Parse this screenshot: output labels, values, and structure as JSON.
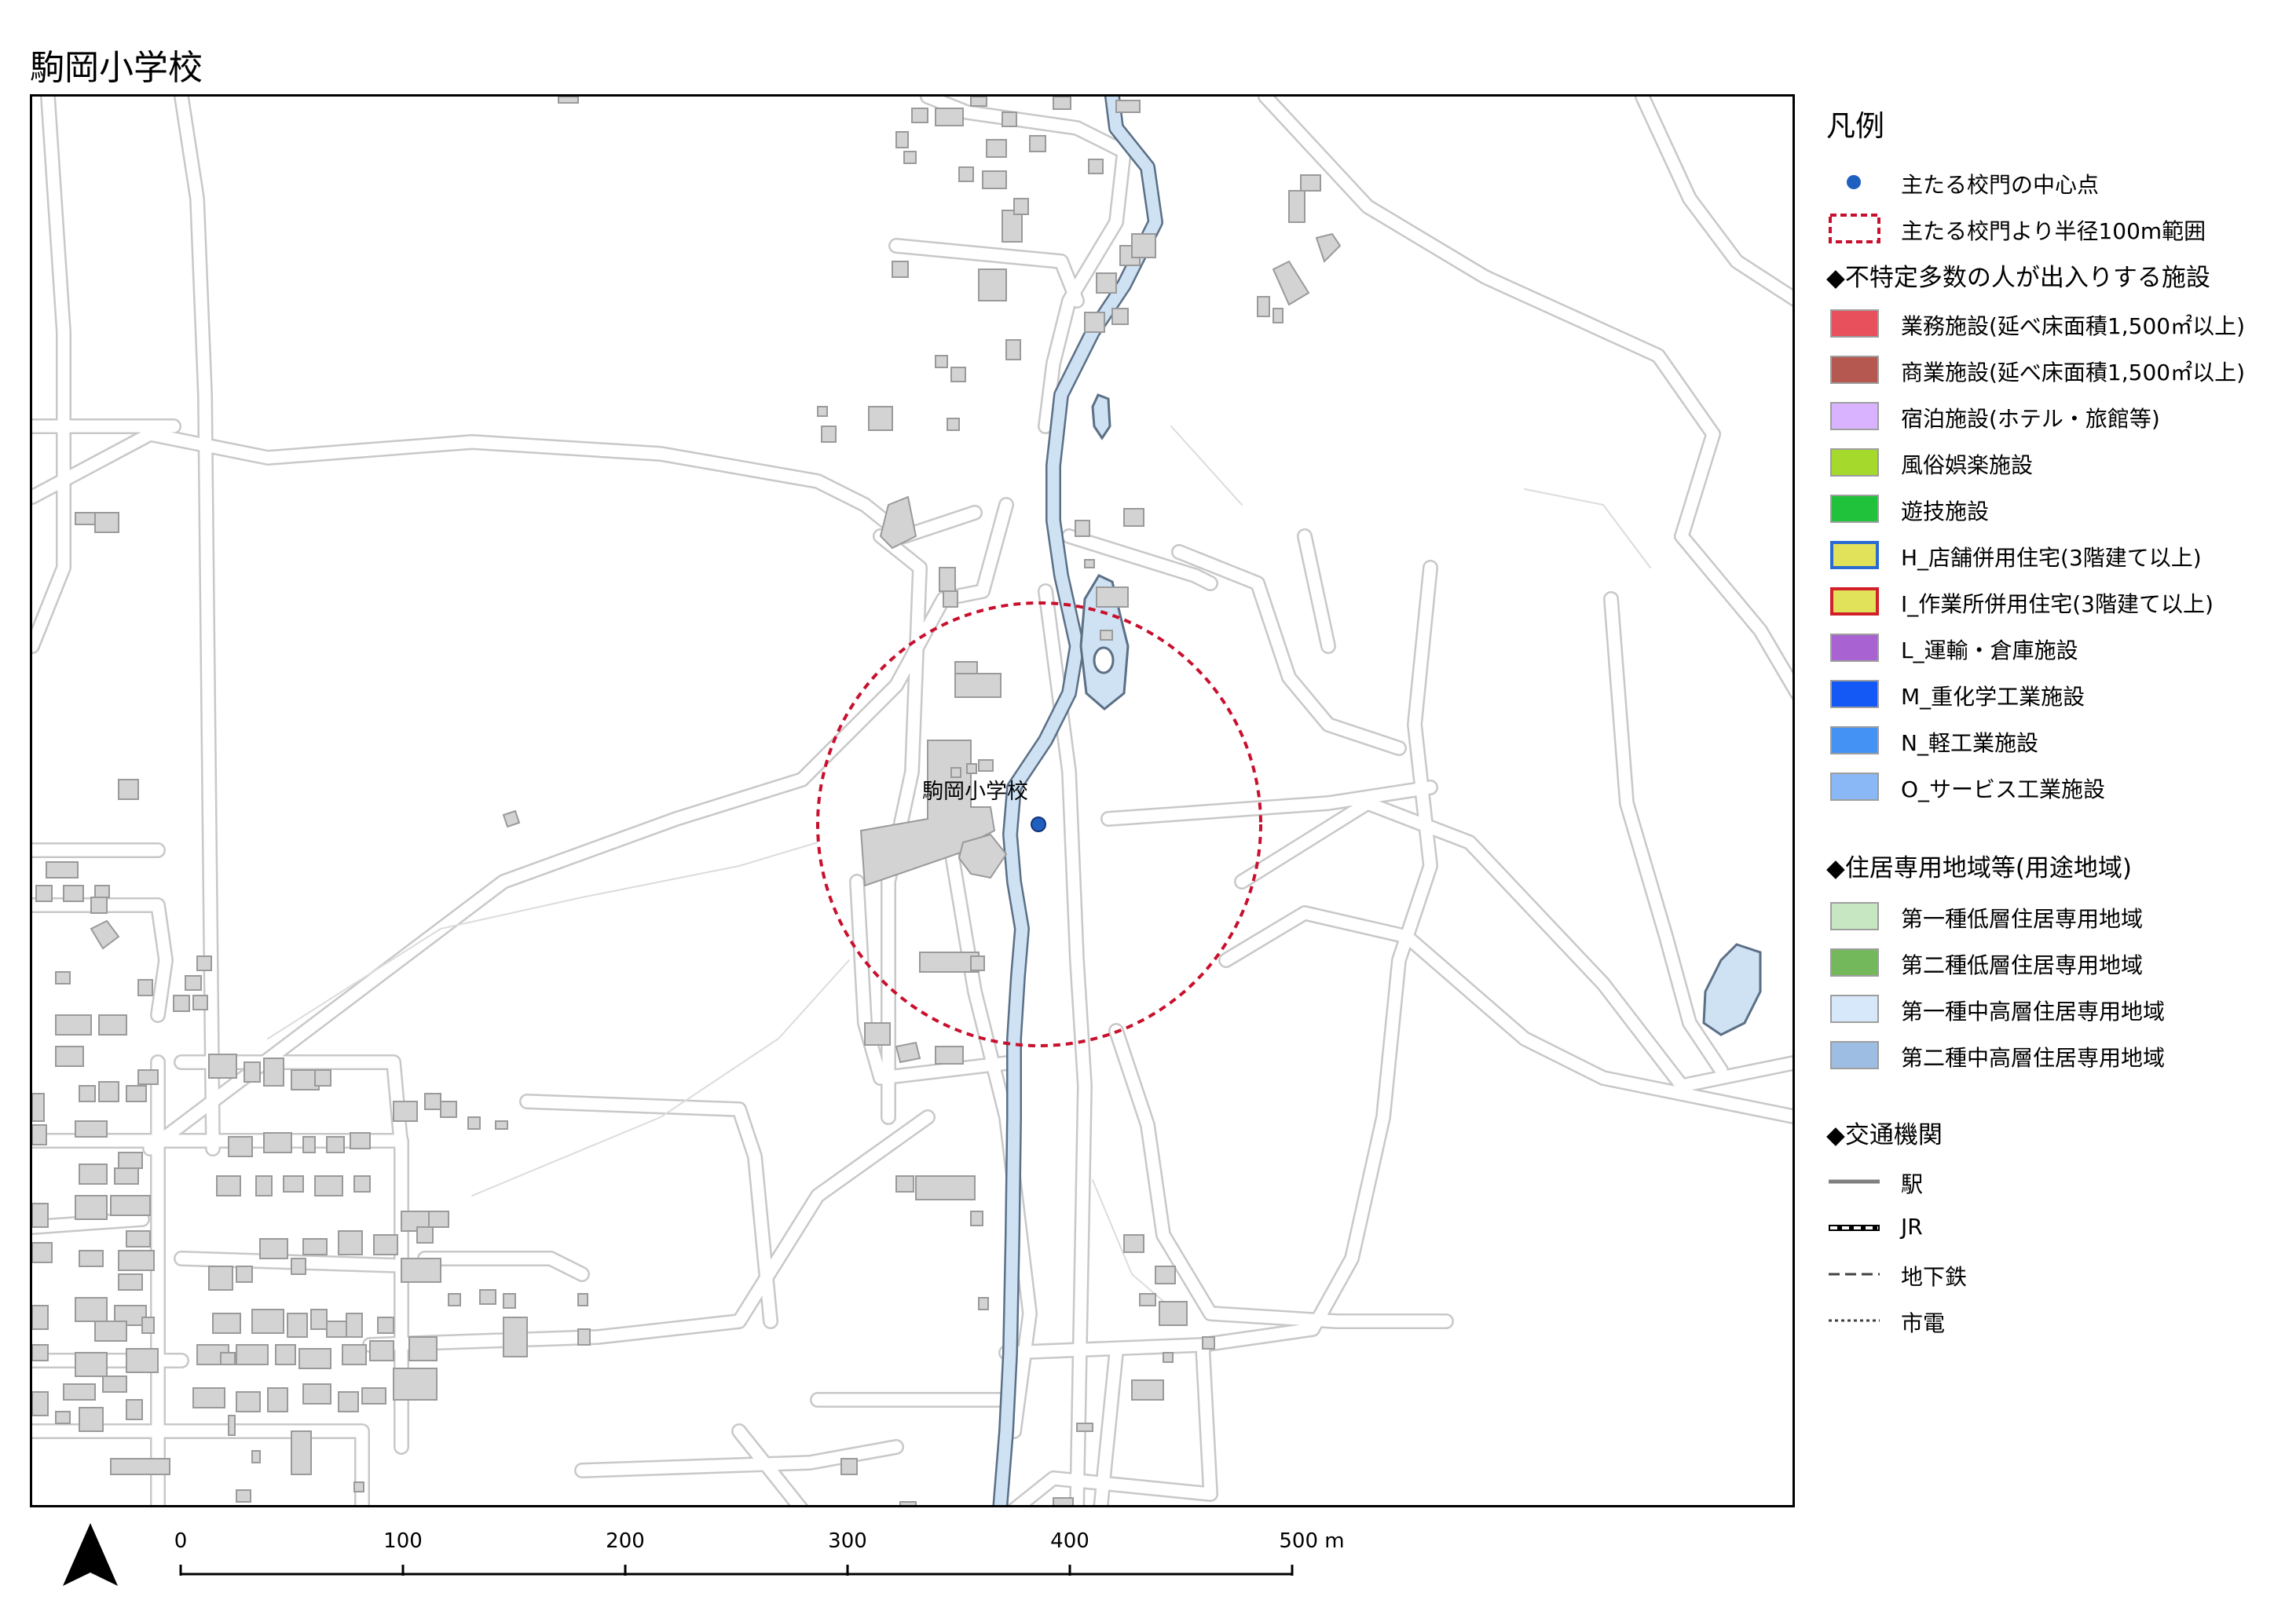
{
  "title": "駒岡小学校",
  "map": {
    "school_label": "駒岡小学校",
    "colors": {
      "building_fill": "#d3d3d3",
      "building_stroke": "#9a9a9a",
      "road": "#c8c8c8",
      "water_fill": "#cfe2f3",
      "water_stroke": "#5b6f86",
      "gate_point": "#1f5fbf",
      "buffer_circle": "#c8102e"
    }
  },
  "legend": {
    "title": "凡例",
    "items": [
      {
        "label": "主たる校門の中心点",
        "symbol": "point",
        "color": "#1f5fbf"
      },
      {
        "label": "主たる校門より半径100m範囲",
        "symbol": "dashed-box",
        "color": "#c8102e"
      }
    ],
    "section_facilities": "◆不特定多数の人が出入りする施設",
    "facilities": [
      {
        "label": "業務施設(延べ床面積1,500㎡以上)",
        "fill": "#e8505b",
        "border": "#9e9e9e"
      },
      {
        "label": "商業施設(延べ床面積1,500㎡以上)",
        "fill": "#b5584f",
        "border": "#9e9e9e"
      },
      {
        "label": "宿泊施設(ホテル・旅館等)",
        "fill": "#d9b3ff",
        "border": "#9e9e9e"
      },
      {
        "label": "風俗娯楽施設",
        "fill": "#a5d92b",
        "border": "#9e9e9e"
      },
      {
        "label": "遊技施設",
        "fill": "#1fc23a",
        "border": "#9e9e9e"
      },
      {
        "label": "H_店舗併用住宅(3階建て以上)",
        "fill": "#e2e25a",
        "border": "#2a6bd1"
      },
      {
        "label": "I_作業所併用住宅(3階建て以上)",
        "fill": "#e2e25a",
        "border": "#d1202a"
      },
      {
        "label": "L_運輸・倉庫施設",
        "fill": "#a862d1",
        "border": "#9e9e9e"
      },
      {
        "label": "M_重化学工業施設",
        "fill": "#1459f5",
        "border": "#9e9e9e"
      },
      {
        "label": "N_軽工業施設",
        "fill": "#4592f5",
        "border": "#9e9e9e"
      },
      {
        "label": "O_サービス工業施設",
        "fill": "#8ab8f7",
        "border": "#9e9e9e"
      }
    ],
    "section_zones": "◆住居専用地域等(用途地域)",
    "zones": [
      {
        "label": "第一種低層住居専用地域",
        "fill": "#c7e6c2",
        "border": "#9e9e9e"
      },
      {
        "label": "第二種低層住居専用地域",
        "fill": "#74b85c",
        "border": "#9e9e9e"
      },
      {
        "label": "第一種中高層住居専用地域",
        "fill": "#d6e8fa",
        "border": "#9e9e9e"
      },
      {
        "label": "第二種中高層住居専用地域",
        "fill": "#9dbde3",
        "border": "#9e9e9e"
      }
    ],
    "section_transport": "◆交通機関",
    "transport": [
      {
        "label": "駅",
        "line": "solid"
      },
      {
        "label": "JR",
        "line": "jr"
      },
      {
        "label": "地下鉄",
        "line": "dashed"
      },
      {
        "label": "市電",
        "line": "dotted"
      }
    ]
  },
  "scale_bar": {
    "ticks": [
      "0",
      "100",
      "200",
      "300",
      "400",
      "500 m"
    ]
  }
}
